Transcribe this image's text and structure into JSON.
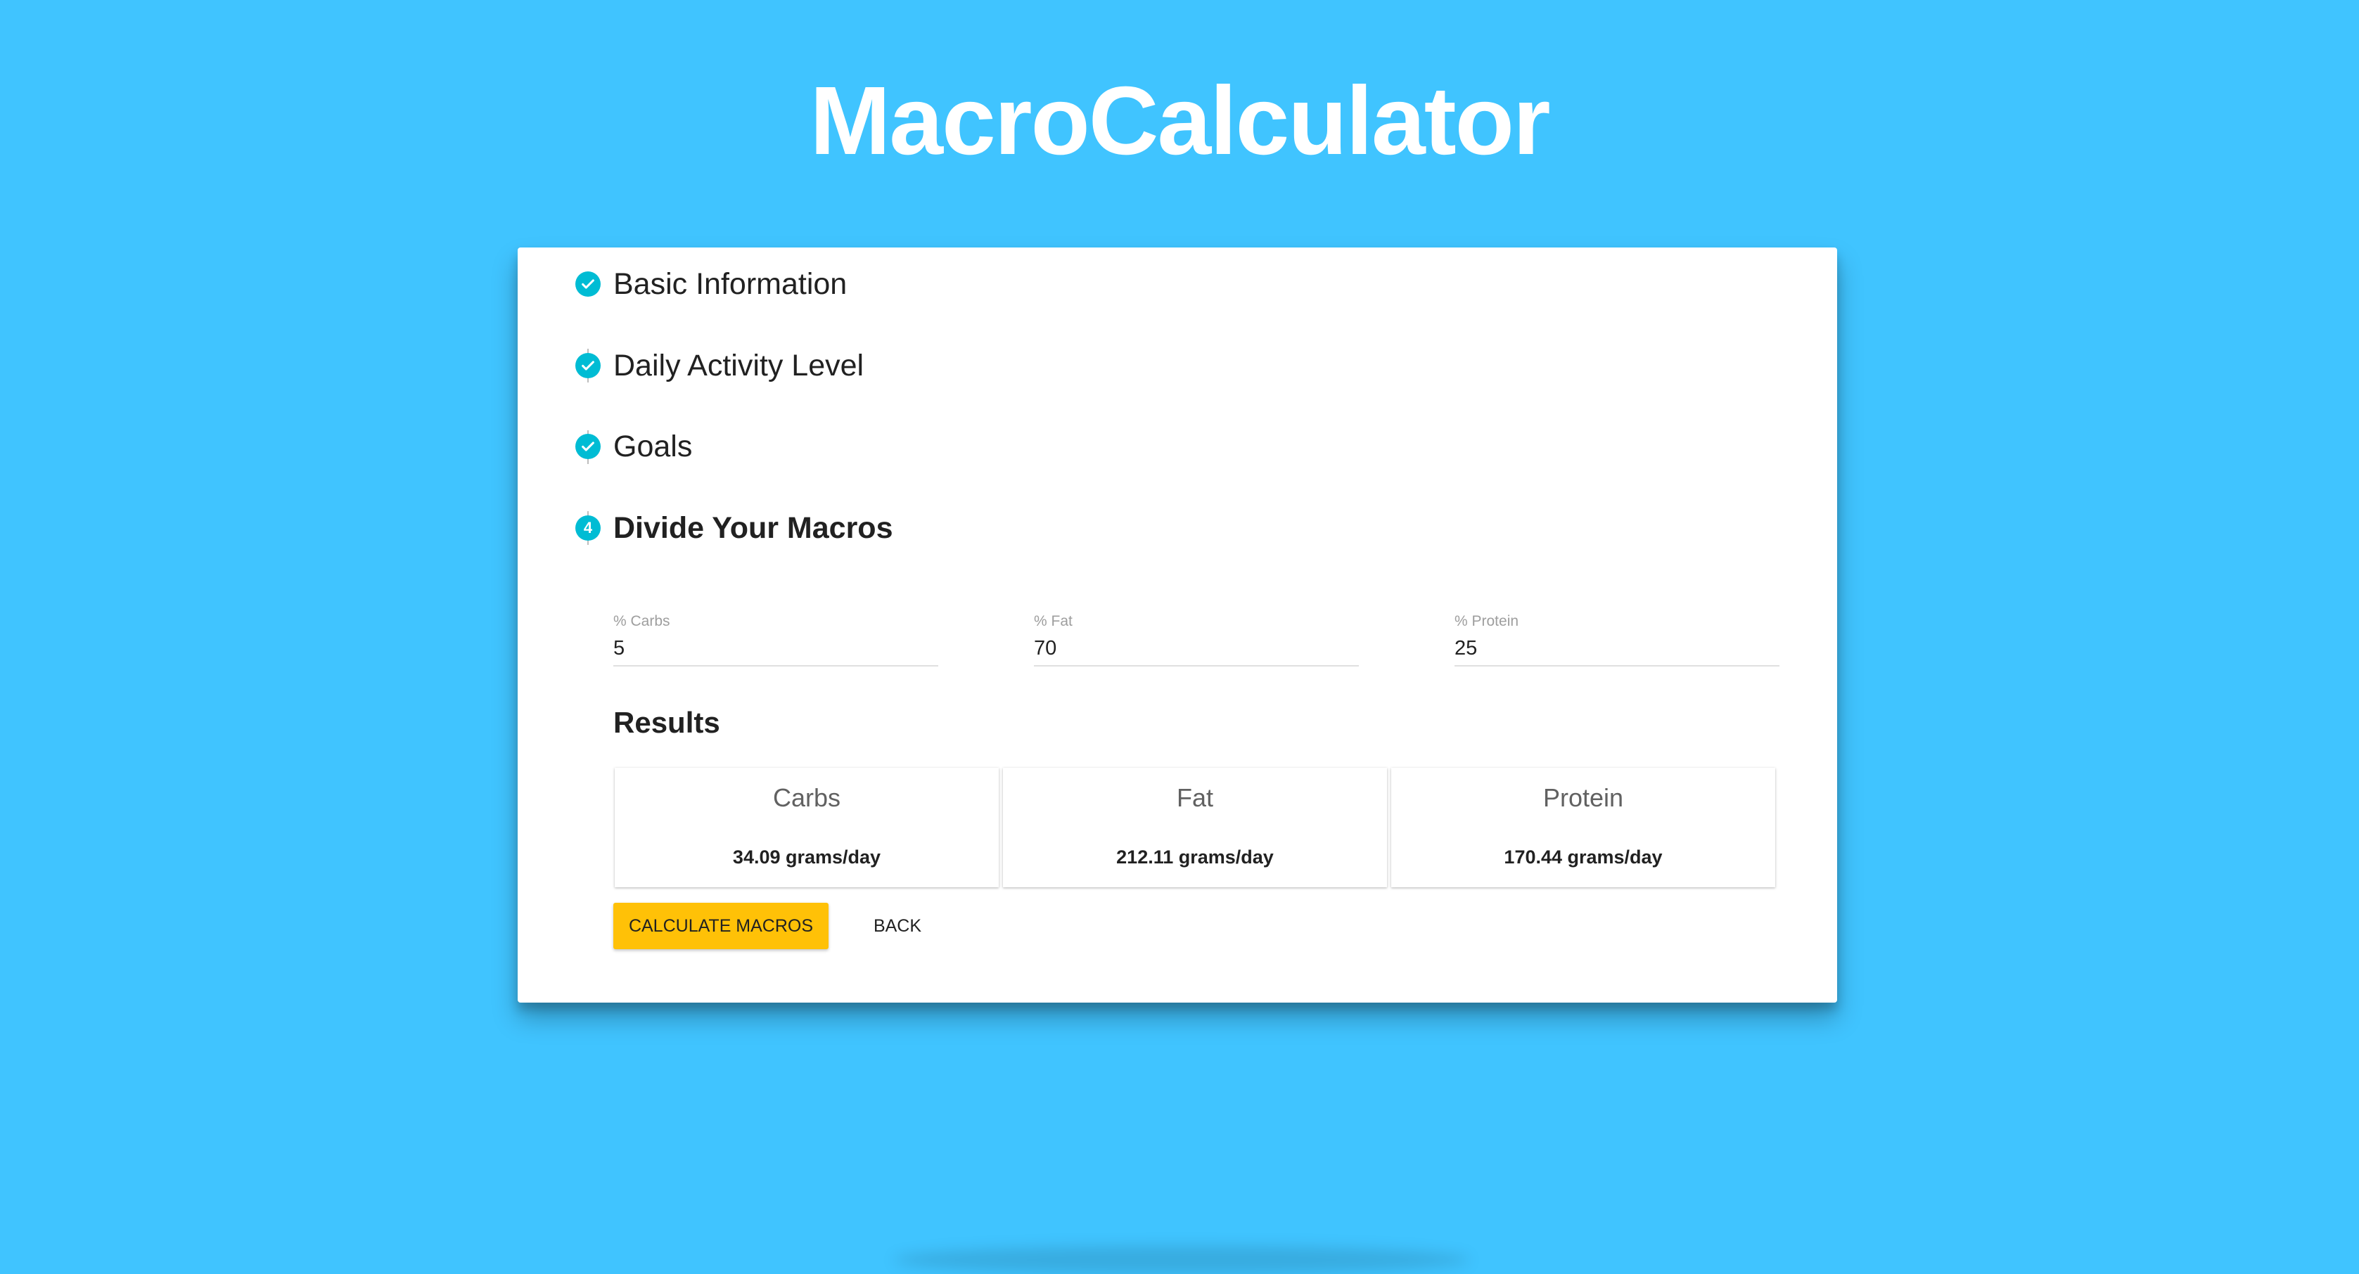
{
  "app": {
    "title": "MacroCalculator"
  },
  "colors": {
    "background": "#40c4ff",
    "step_accent": "#00bcd4",
    "primary_button": "#ffc107"
  },
  "stepper": {
    "steps": [
      {
        "label": "Basic Information",
        "state": "completed",
        "icon": "check-circle-icon"
      },
      {
        "label": "Daily Activity Level",
        "state": "completed",
        "icon": "check-circle-icon"
      },
      {
        "label": "Goals",
        "state": "completed",
        "icon": "check-circle-icon"
      },
      {
        "label": "Divide Your Macros",
        "state": "active",
        "number": "4"
      }
    ]
  },
  "macros_form": {
    "carbs": {
      "label": "% Carbs",
      "value": "5"
    },
    "fat": {
      "label": "% Fat",
      "value": "70"
    },
    "protein": {
      "label": "% Protein",
      "value": "25"
    }
  },
  "results": {
    "title": "Results",
    "tiles": [
      {
        "title": "Carbs",
        "value": "34.09 grams/day"
      },
      {
        "title": "Fat",
        "value": "212.11 grams/day"
      },
      {
        "title": "Protein",
        "value": "170.44 grams/day"
      }
    ]
  },
  "actions": {
    "calculate_label": "CALCULATE MACROS",
    "back_label": "BACK"
  }
}
